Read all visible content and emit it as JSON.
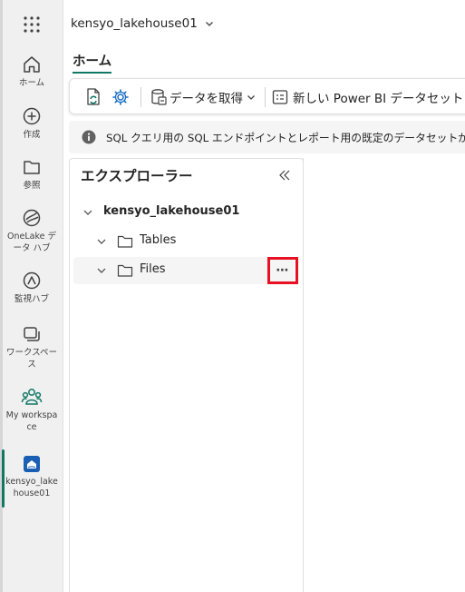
{
  "workspace": {
    "name": "kensyo_lakehouse01"
  },
  "tabs": {
    "home": "ホーム"
  },
  "sidebar": {
    "items": [
      {
        "label": "ホーム",
        "icon": "home-icon"
      },
      {
        "label": "作成",
        "icon": "create-icon"
      },
      {
        "label": "参照",
        "icon": "browse-icon"
      },
      {
        "label": "OneLake データ ハブ",
        "icon": "onelake-icon"
      },
      {
        "label": "監視ハブ",
        "icon": "monitor-icon"
      },
      {
        "label": "ワークスペース",
        "icon": "workspaces-icon"
      },
      {
        "label": "My workspace",
        "icon": "my-workspace-icon"
      },
      {
        "label": "kensyo_lakehouse01",
        "icon": "lakehouse-icon"
      }
    ]
  },
  "toolbar": {
    "get_data": "データを取得",
    "new_dataset": "新しい Power BI データセット"
  },
  "infobar": {
    "text": "SQL クエリ用の SQL エンドポイントとレポート用の既定のデータセットが"
  },
  "explorer": {
    "title": "エクスプローラー",
    "root": "kensyo_lakehouse01",
    "tables": "Tables",
    "files": "Files",
    "more": "⋯"
  },
  "colors": {
    "accent": "#117865",
    "highlight": "#e81123"
  }
}
